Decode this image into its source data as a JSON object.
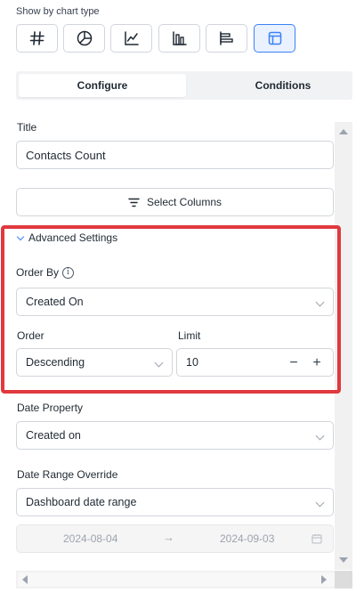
{
  "chart_type_section": {
    "label": "Show by chart type",
    "types": [
      {
        "name": "number",
        "icon": "hash-icon",
        "active": false
      },
      {
        "name": "pie",
        "icon": "pie-chart-icon",
        "active": false
      },
      {
        "name": "line",
        "icon": "line-chart-icon",
        "active": false
      },
      {
        "name": "bar",
        "icon": "bar-chart-icon",
        "active": false
      },
      {
        "name": "horizontal-bar",
        "icon": "horizontal-bar-chart-icon",
        "active": false
      },
      {
        "name": "table",
        "icon": "table-icon",
        "active": true
      }
    ],
    "active_color": "#3b82f6"
  },
  "tabs": {
    "configure": "Configure",
    "conditions": "Conditions",
    "active": "Configure"
  },
  "title_field": {
    "label": "Title",
    "value": "Contacts Count"
  },
  "select_columns": {
    "label": "Select Columns",
    "icon": "filter-lines-icon"
  },
  "advanced": {
    "label": "Advanced Settings",
    "expanded": true,
    "highlight_color": "#e0393e",
    "order_by": {
      "label": "Order By",
      "info_icon": "info-icon",
      "value": "Created On"
    },
    "order": {
      "label": "Order",
      "value": "Descending"
    },
    "limit": {
      "label": "Limit",
      "value": "10",
      "decrement": "−",
      "increment": "+"
    }
  },
  "date_property": {
    "label": "Date Property",
    "value": "Created on"
  },
  "date_range_override": {
    "label": "Date Range Override",
    "value": "Dashboard date range",
    "start_date": "2024-08-04",
    "arrow": "→",
    "end_date": "2024-09-03",
    "disabled": true
  }
}
